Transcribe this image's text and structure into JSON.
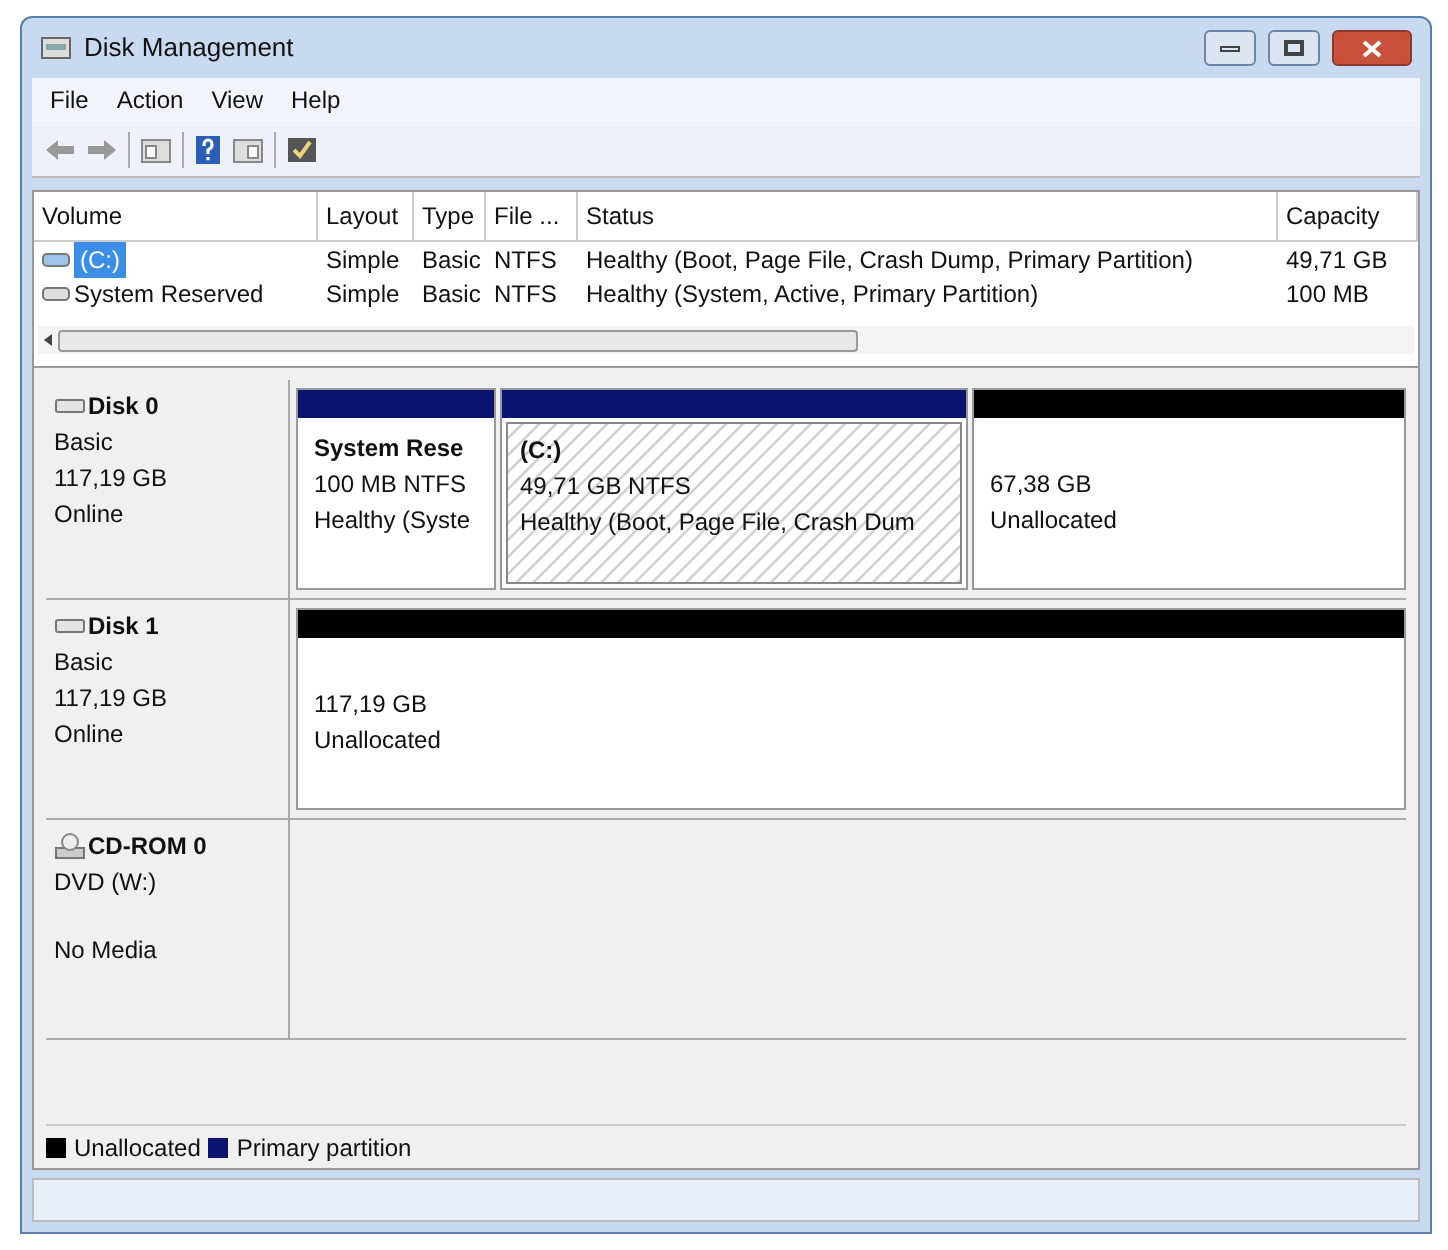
{
  "window": {
    "title": "Disk Management"
  },
  "menu": [
    "File",
    "Action",
    "View",
    "Help"
  ],
  "table": {
    "columns": [
      "Volume",
      "Layout",
      "Type",
      "File ...",
      "Status",
      "Capacity"
    ],
    "rows": [
      {
        "cells": [
          "(C:)",
          "Simple",
          "Basic",
          "NTFS",
          "Healthy (Boot, Page File, Crash Dump, Primary Partition)",
          "49,71 GB"
        ],
        "selected": true
      },
      {
        "cells": [
          "System Reserved",
          "Simple",
          "Basic",
          "NTFS",
          "Healthy (System, Active, Primary Partition)",
          "100 MB"
        ],
        "selected": false
      }
    ]
  },
  "disks": [
    {
      "kind": "disk",
      "name": "Disk 0",
      "lines": [
        "Basic",
        "117,19 GB",
        "Online"
      ],
      "partitions": [
        {
          "kind": "primary",
          "selected": false,
          "title": "System Rese",
          "lines": [
            "100 MB NTFS",
            "Healthy (Syste"
          ]
        },
        {
          "kind": "primary",
          "selected": true,
          "title": "(C:)",
          "lines": [
            "49,71 GB NTFS",
            "Healthy (Boot, Page File, Crash Dum"
          ]
        },
        {
          "kind": "unallocated",
          "selected": false,
          "lines": [
            "67,38 GB",
            "Unallocated"
          ]
        }
      ]
    },
    {
      "kind": "disk",
      "name": "Disk 1",
      "lines": [
        "Basic",
        "117,19 GB",
        "Online"
      ],
      "partitions": [
        {
          "kind": "unallocated",
          "selected": false,
          "lines": [
            "117,19 GB",
            "Unallocated"
          ]
        }
      ]
    },
    {
      "kind": "cdrom",
      "name": "CD-ROM 0",
      "lines": [
        "DVD (W:)",
        "No Media"
      ]
    }
  ],
  "legend": [
    {
      "label": "Unallocated",
      "color": "#000000"
    },
    {
      "label": "Primary partition",
      "color": "#0a1470"
    }
  ]
}
